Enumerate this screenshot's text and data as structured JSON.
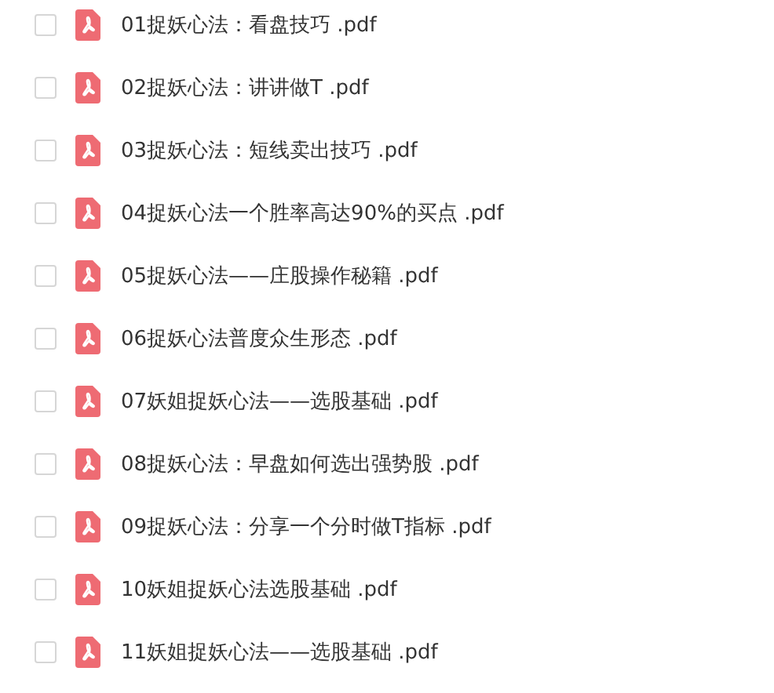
{
  "files": [
    {
      "name": "01捉妖心法：看盘技巧 .pdf",
      "checked": false
    },
    {
      "name": "02捉妖心法：讲讲做T .pdf",
      "checked": false
    },
    {
      "name": "03捉妖心法：短线卖出技巧 .pdf",
      "checked": false
    },
    {
      "name": "04捉妖心法一个胜率高达90%的买点 .pdf",
      "checked": false
    },
    {
      "name": "05捉妖心法——庄股操作秘籍 .pdf",
      "checked": false
    },
    {
      "name": "06捉妖心法普度众生形态 .pdf",
      "checked": false
    },
    {
      "name": "07妖姐捉妖心法——选股基础 .pdf",
      "checked": false
    },
    {
      "name": "08捉妖心法：早盘如何选出强势股 .pdf",
      "checked": false
    },
    {
      "name": "09捉妖心法：分享一个分时做T指标 .pdf",
      "checked": false
    },
    {
      "name": "10妖姐捉妖心法选股基础 .pdf",
      "checked": false
    },
    {
      "name": "11妖姐捉妖心法——选股基础 .pdf",
      "checked": false
    }
  ]
}
